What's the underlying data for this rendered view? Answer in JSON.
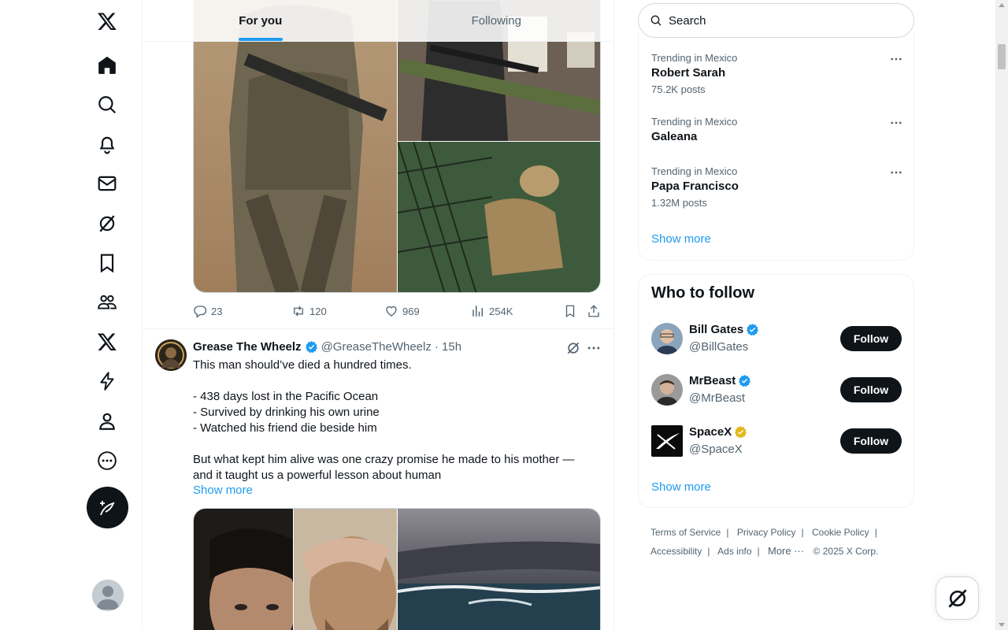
{
  "nav": {
    "items": [
      {
        "name": "x-logo-icon"
      },
      {
        "name": "home-icon"
      },
      {
        "name": "explore-icon"
      },
      {
        "name": "notifications-icon"
      },
      {
        "name": "messages-icon"
      },
      {
        "name": "grok-icon"
      },
      {
        "name": "bookmarks-icon"
      },
      {
        "name": "communities-icon"
      },
      {
        "name": "premium-icon"
      },
      {
        "name": "verified-orgs-icon"
      },
      {
        "name": "profile-icon"
      },
      {
        "name": "more-icon"
      }
    ]
  },
  "tabs": [
    {
      "label": "For you",
      "active": true
    },
    {
      "label": "Following",
      "active": false
    }
  ],
  "tweet1": {
    "actions": {
      "replies": "23",
      "reposts": "120",
      "likes": "969",
      "views": "254K"
    }
  },
  "tweet2": {
    "name": "Grease The Wheelz",
    "handle": "@GreaseTheWheelz",
    "time": "· 15h",
    "body": "This man should’ve died a hundred times.\n\n- 438 days lost in the Pacific Ocean\n- Survived by drinking his own urine\n- Watched his friend die beside him\n\nBut what kept him alive was one crazy promise he made to his mother —\nand it taught us a powerful lesson about human",
    "show_more": "Show more"
  },
  "search": {
    "placeholder": "Search"
  },
  "trends": [
    {
      "context": "Trending in Mexico",
      "name": "Robert Sarah",
      "count": "75.2K posts"
    },
    {
      "context": "Trending in Mexico",
      "name": "Galeana",
      "count": ""
    },
    {
      "context": "Trending in Mexico",
      "name": "Papa Francisco",
      "count": "1.32M posts"
    }
  ],
  "trends_show_more": "Show more",
  "who_to_follow": {
    "title": "Who to follow",
    "accounts": [
      {
        "name": "Bill Gates",
        "handle": "@BillGates",
        "badge": "blue",
        "button": "Follow"
      },
      {
        "name": "MrBeast",
        "handle": "@MrBeast",
        "badge": "blue",
        "button": "Follow"
      },
      {
        "name": "SpaceX",
        "handle": "@SpaceX",
        "badge": "gold",
        "button": "Follow"
      }
    ],
    "show_more": "Show more"
  },
  "footer": {
    "links": [
      "Terms of Service",
      "Privacy Policy",
      "Cookie Policy",
      "Accessibility",
      "Ads info",
      "More ···"
    ],
    "copyright": "© 2025 X Corp."
  },
  "colors": {
    "accent": "#1d9bf0",
    "text": "#0f1419",
    "muted": "#536471",
    "gold": "#e2b719"
  }
}
